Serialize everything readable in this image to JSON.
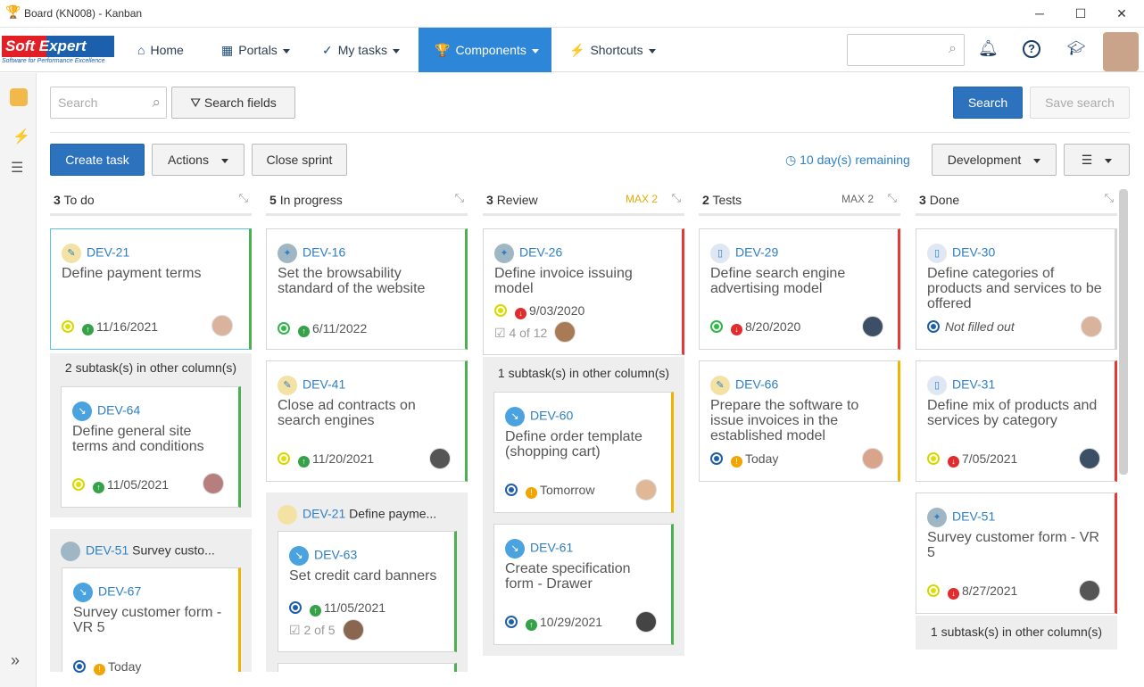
{
  "window": {
    "title": "Board (KN008) - Kanban",
    "controls": [
      "─",
      "☐",
      "✕"
    ]
  },
  "brand": {
    "logo_top": "Soft Expert",
    "logo_sub": "Software for Performance Excellence"
  },
  "nav": {
    "home": "Home",
    "portals": "Portals",
    "my_tasks": "My tasks",
    "components": "Components",
    "shortcuts": "Shortcuts"
  },
  "search": {
    "placeholder": "Search",
    "fields_label": "Search fields",
    "search_btn": "Search",
    "save_btn": "Save search"
  },
  "toolbar": {
    "create": "Create task",
    "actions": "Actions",
    "close_sprint": "Close sprint",
    "remaining": "10 day(s) remaining",
    "board_select": "Development"
  },
  "columns": [
    {
      "count": "3",
      "name": "To do",
      "max": ""
    },
    {
      "count": "5",
      "name": "In progress",
      "max": ""
    },
    {
      "count": "3",
      "name": "Review",
      "max": "MAX 2"
    },
    {
      "count": "2",
      "name": "Tests",
      "max": "MAX 2"
    },
    {
      "count": "3",
      "name": "Done",
      "max": ""
    }
  ],
  "cards": {
    "c21": {
      "id": "DEV-21",
      "title": "Define payment terms",
      "date": "11/16/2021"
    },
    "c16": {
      "id": "DEV-16",
      "title": "Set the browsability standard of the website",
      "date": "6/11/2022"
    },
    "c26": {
      "id": "DEV-26",
      "title": "Define invoice issuing model",
      "date": "9/03/2020",
      "check": "4 of 12"
    },
    "c29": {
      "id": "DEV-29",
      "title": "Define search engine advertising model",
      "date": "8/20/2020"
    },
    "c30": {
      "id": "DEV-30",
      "title": "Define categories of products and services to be offered",
      "date": "Not filled out"
    },
    "c64": {
      "id": "DEV-64",
      "title": "Define general site terms and conditions",
      "date": "11/05/2021"
    },
    "c41": {
      "id": "DEV-41",
      "title": "Close ad contracts on search engines",
      "date": "11/20/2021"
    },
    "c66": {
      "id": "DEV-66",
      "title": "Prepare the software to issue invoices in the established model",
      "date": "Today"
    },
    "c31": {
      "id": "DEV-31",
      "title": "Define mix of products and services by category",
      "date": "7/05/2021"
    },
    "c60": {
      "id": "DEV-60",
      "title": "Define order template (shopping cart)",
      "date": "Tomorrow"
    },
    "c61": {
      "id": "DEV-61",
      "title": "Create specification form - Drawer",
      "date": "10/29/2021"
    },
    "c63": {
      "id": "DEV-63",
      "title": "Set credit card banners",
      "date": "11/05/2021",
      "check": "2 of 5"
    },
    "c51": {
      "id": "DEV-51",
      "title": "Survey customer form - VR 5",
      "date": "8/27/2021"
    },
    "c67": {
      "id": "DEV-67",
      "title": "Survey customer form - VR 5",
      "date": "Today"
    }
  },
  "groups": {
    "g21": {
      "id": "DEV-21",
      "title": "Define payme..."
    },
    "g51": {
      "id": "DEV-51",
      "title": "Survey custo..."
    }
  },
  "subtasks": {
    "s2": "2 subtask(s) in other column(s)",
    "s1": "1 subtask(s) in other column(s)"
  }
}
